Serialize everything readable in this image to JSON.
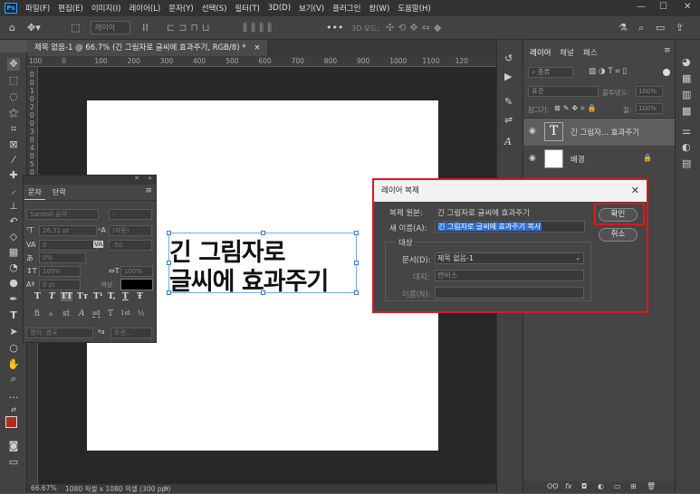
{
  "menubar": {
    "app_icon": "Ps",
    "items": [
      "파일(F)",
      "편집(E)",
      "이미지(I)",
      "레이어(L)",
      "문자(Y)",
      "선택(S)",
      "필터(T)",
      "3D(D)",
      "보기(V)",
      "플러그인",
      "창(W)",
      "도움말(H)"
    ],
    "window_controls": [
      "—",
      "☐",
      "✕"
    ]
  },
  "options": {
    "layer_select": "레이어",
    "mode_3d": "3D 모드:"
  },
  "document": {
    "tab_title": "제목 없음-1 @ 66.7% (긴 그림자로 글씨에 효과주기, RGB/8) *",
    "close": "×",
    "text_line1": "긴 그림자로",
    "text_line2": "글씨에 효과주기",
    "ruler_h": [
      "100",
      "0",
      "100",
      "200",
      "300",
      "400",
      "500",
      "600",
      "700",
      "800",
      "900",
      "1000",
      "1100",
      "120"
    ],
    "ruler_v": [
      "0",
      "0",
      "1",
      "0",
      "2",
      "0",
      "0",
      "3",
      "0",
      "4",
      "0",
      "5",
      "0",
      "6",
      "0",
      "7",
      "0",
      "8",
      "0",
      "9",
      "0"
    ]
  },
  "status": {
    "zoom": "66.67%",
    "doc_info": "1080 픽셀 x 1080 픽셀 (300 ppi)",
    "arrow": ">"
  },
  "char_panel": {
    "tabs": [
      "문자",
      "단락"
    ],
    "font_family": "Sandoll 삼각",
    "font_style": "-",
    "size": "26.31 pt",
    "leading": "(자동)",
    "kerning": "0",
    "tracking": "-50",
    "tsume": "0%",
    "vscale": "100%",
    "hscale": "100%",
    "baseline": "0 pt",
    "color_label": "색상:",
    "format_buttons": [
      "T",
      "T",
      "TT",
      "Tт",
      "T¹",
      "T,",
      "T",
      "Ŧ"
    ],
    "opentype_buttons": [
      "fi",
      "ℴ",
      "st",
      "A",
      "ad",
      "T",
      "1st",
      "½"
    ],
    "language": "영어: 영국",
    "aa_label": "ªa",
    "aa_value": "뚜렷..."
  },
  "layers": {
    "tabs": [
      "레이어",
      "채널",
      "패스"
    ],
    "search": "종류",
    "blend": "표준",
    "opacity_label": "불투명도:",
    "opacity": "100%",
    "lock_label": "잠그기:",
    "fill_label": "칠:",
    "fill": "100%",
    "items": [
      {
        "name": "긴 그림자... 효과주기",
        "thumb": "T"
      },
      {
        "name": "배경",
        "thumb": ""
      }
    ],
    "footer_icons": [
      "ʘʘ",
      "fx",
      "◘",
      "◐",
      "▭",
      "⊞",
      "🗑"
    ]
  },
  "dialog": {
    "title": "레이어 복제",
    "close": "✕",
    "source_label": "복제 원본:",
    "source_value": "긴 그림자로 글씨에 효과주기",
    "name_label": "새 이름(A):",
    "name_value": "긴 그림자로 글씨에 효과주기 복사",
    "target_legend": "대상",
    "doc_label": "문서(D):",
    "doc_value": "제목 없음-1",
    "artboard_label": "대지:",
    "artboard_value": "캔버스",
    "target_name_label": "이름(N):",
    "ok": "확인",
    "cancel": "취소"
  }
}
